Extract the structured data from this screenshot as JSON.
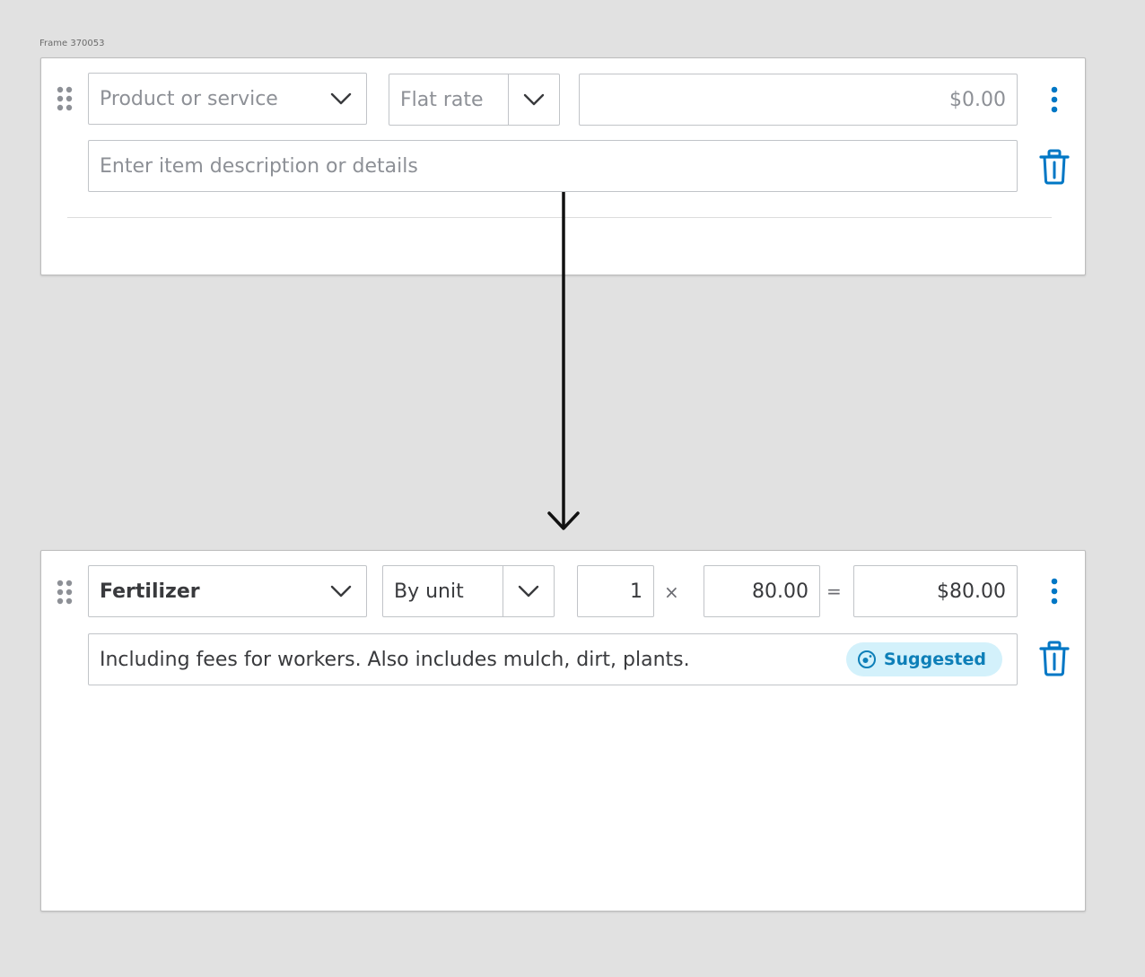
{
  "frame": {
    "label": "Frame 370053"
  },
  "before": {
    "product": {
      "placeholder": "Product or service"
    },
    "rate_type": {
      "selected": "Flat rate"
    },
    "amount": {
      "placeholder": "$0.00"
    },
    "description": {
      "placeholder": "Enter item description or details"
    }
  },
  "after": {
    "product": {
      "value": "Fertilizer"
    },
    "rate_type": {
      "selected": "By unit"
    },
    "quantity": {
      "value": "1"
    },
    "multiply_symbol": "×",
    "rate": {
      "value": "80.00"
    },
    "equals_symbol": "=",
    "amount": {
      "value": "$80.00"
    },
    "description": {
      "value": "Including fees for workers. Also includes mulch, dirt, plants."
    },
    "suggested_badge": {
      "label": "Suggested"
    }
  },
  "icons": {
    "drag": "drag-handle-icon",
    "chevron": "chevron-down-icon",
    "kebab": "kebab-menu-icon",
    "trash": "trash-icon",
    "suggest": "ai-suggest-icon",
    "arrow": "arrow-down-icon"
  },
  "colors": {
    "accent": "#0077c5",
    "badge_bg": "#d3f1fb",
    "badge_text": "#0d7fb8",
    "border": "#c1c4c8",
    "placeholder": "#8d9096",
    "canvas": "#e1e1e1"
  }
}
